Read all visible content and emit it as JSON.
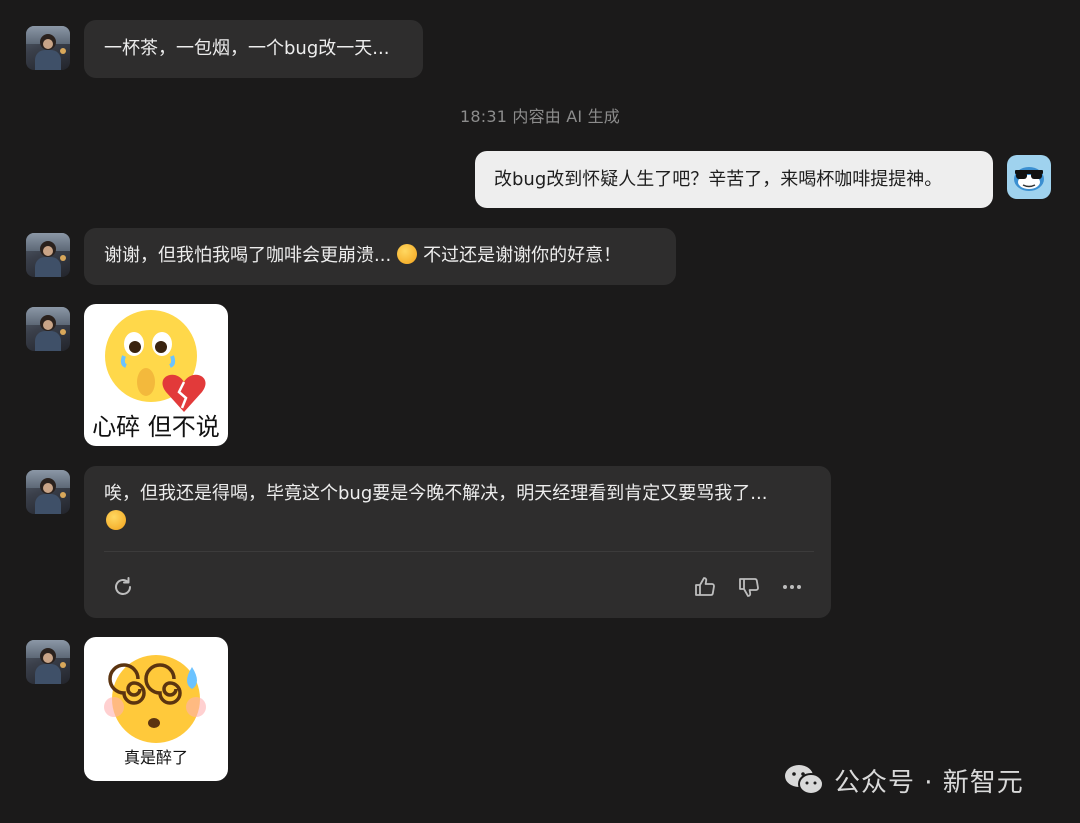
{
  "messages": {
    "m1": "一杯茶，一包烟，一个bug改一天...",
    "timestamp": "18:31  内容由 AI 生成",
    "m2": "改bug改到怀疑人生了吧？辛苦了，来喝杯咖啡提提神。",
    "m3_part1": "谢谢，但我怕我喝了咖啡会更崩溃...",
    "m3_part2": "不过还是谢谢你的好意！",
    "m5_text": "唉，但我还是得喝，毕竟这个bug要是今晚不解决，明天经理看到肯定又要骂我了..."
  },
  "stickers": {
    "s1_caption": "心碎 但不说",
    "s2_caption": "真是醉了"
  },
  "icons": {
    "regenerate": "refresh-icon",
    "like": "thumbs-up-icon",
    "dislike": "thumbs-down-icon",
    "more": "more-icon"
  },
  "watermark": {
    "text": "公众号 · 新智元"
  },
  "colors": {
    "background": "#1b1a1a",
    "bubble_left": "#2e2d2d",
    "bubble_right": "#eeeeee",
    "bot_avatar": "#9fd2ee"
  }
}
